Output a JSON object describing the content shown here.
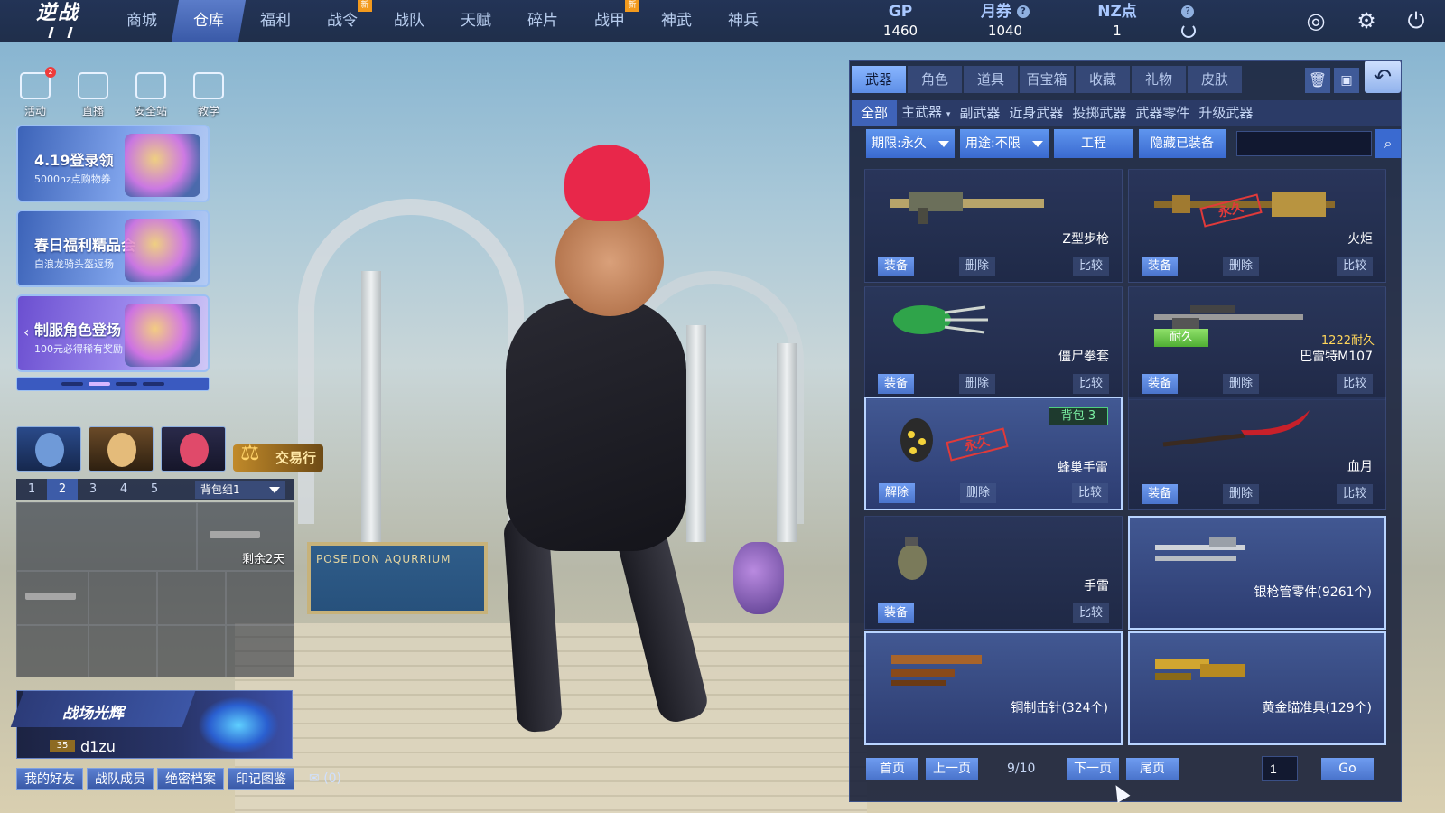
{
  "logo": {
    "text": "逆战"
  },
  "nav": {
    "items": [
      {
        "label": "商城",
        "new": ""
      },
      {
        "label": "仓库",
        "new": ""
      },
      {
        "label": "福利",
        "new": ""
      },
      {
        "label": "战令",
        "new": "新"
      },
      {
        "label": "战队",
        "new": ""
      },
      {
        "label": "天赋",
        "new": ""
      },
      {
        "label": "碎片",
        "new": ""
      },
      {
        "label": "战甲",
        "new": "新"
      },
      {
        "label": "神武",
        "new": ""
      },
      {
        "label": "神兵",
        "new": ""
      }
    ],
    "active_index": 1
  },
  "currency": {
    "gp": {
      "label": "GP",
      "value": "1460"
    },
    "ticket": {
      "label": "月券",
      "value": "1040"
    },
    "nz": {
      "label": "NZ点",
      "value": "1"
    },
    "help": "?"
  },
  "quick": [
    {
      "label": "活动",
      "badge": "2"
    },
    {
      "label": "直播",
      "badge": ""
    },
    {
      "label": "安全站",
      "badge": ""
    },
    {
      "label": "教学",
      "badge": ""
    }
  ],
  "promos": [
    {
      "title": "4.19登录领",
      "subtitle": "5000nz点购物券"
    },
    {
      "title": "春日福利精品会",
      "subtitle": "白浪龙骑头盔返场"
    },
    {
      "title": "制服角色登场",
      "subtitle": "100元必得稀有奖励"
    }
  ],
  "market": {
    "label": "交易行"
  },
  "loadout": {
    "tabs": [
      "1",
      "2",
      "3",
      "4",
      "5"
    ],
    "active": "2",
    "group": "背包组1",
    "remain": "剩余2天"
  },
  "scene": {
    "sign": "POSEIDON AQURRIUM"
  },
  "glory": {
    "title": "战场光辉",
    "level": "35",
    "username": "d1zu"
  },
  "social": {
    "buttons": [
      "我的好友",
      "战队成员",
      "绝密档案",
      "印记图鉴"
    ],
    "mail_count": "(0)"
  },
  "inventory": {
    "categories": [
      "武器",
      "角色",
      "道具",
      "百宝箱",
      "收藏",
      "礼物",
      "皮肤"
    ],
    "active_category": "武器",
    "subtabs": [
      "全部",
      "主武器",
      "副武器",
      "近身武器",
      "投掷武器",
      "武器零件",
      "升级武器"
    ],
    "active_subtab": "全部",
    "filters": {
      "period": "期限:永久",
      "usage": "用途:不限",
      "engineer": "工程",
      "hide": "隐藏已装备"
    },
    "search_placeholder": "",
    "actions": {
      "equip": "装备",
      "delete": "删除",
      "compare": "比较",
      "unequip": "解除"
    },
    "items": [
      {
        "name": "Z型步枪",
        "perm": ""
      },
      {
        "name": "火炬",
        "perm": "永久"
      },
      {
        "name": "僵尸拳套",
        "perm": ""
      },
      {
        "name": "巴雷特M107",
        "perm": "",
        "durability": "1222耐久",
        "tag": "耐久"
      },
      {
        "name": "蜂巢手雷",
        "perm": "永久",
        "bag": "背包 3"
      },
      {
        "name": "血月",
        "perm": ""
      },
      {
        "name": "手雷",
        "perm": ""
      },
      {
        "name": "银枪管零件(9261个)",
        "perm": ""
      },
      {
        "name": "铜制击针(324个)",
        "perm": ""
      },
      {
        "name": "黄金瞄准具(129个)",
        "perm": ""
      }
    ],
    "pagination": {
      "first": "首页",
      "prev": "上一页",
      "count": "9/10",
      "next": "下一页",
      "last": "尾页",
      "input": "1",
      "go": "Go"
    }
  }
}
